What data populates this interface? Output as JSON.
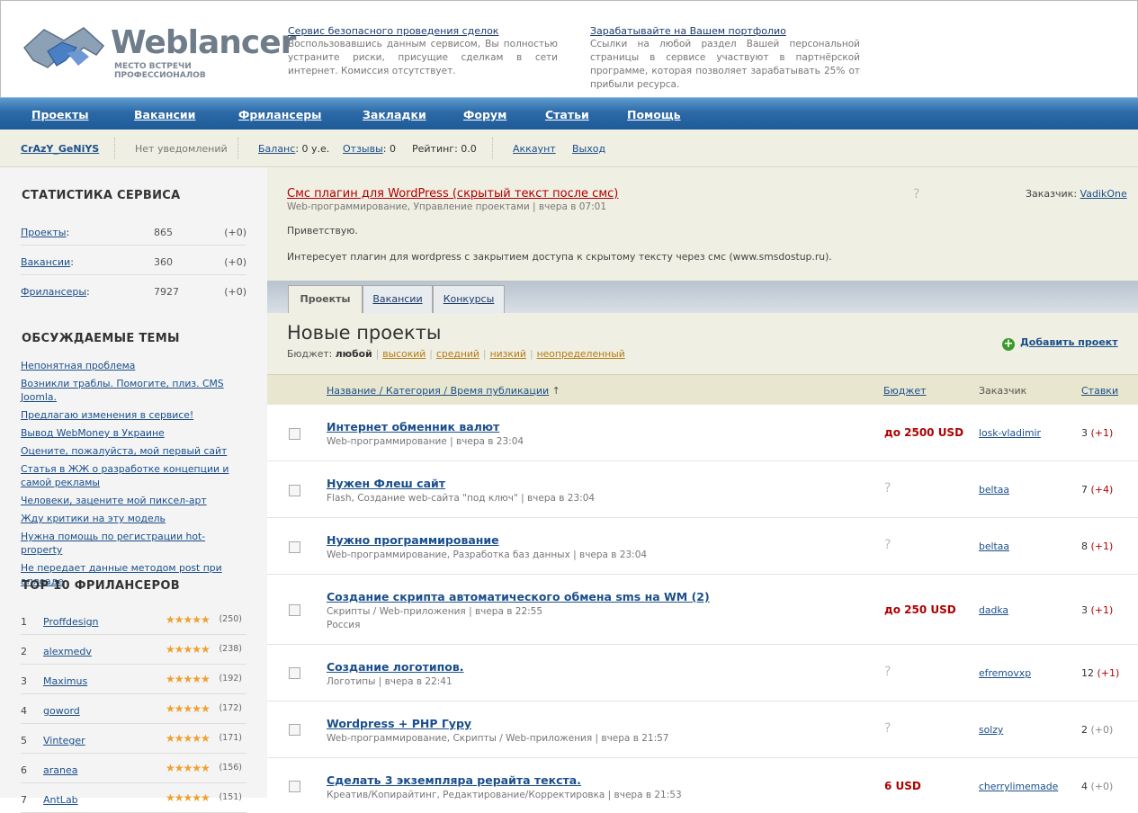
{
  "header": {
    "logo_word": "Weblancer",
    "logo_sub": "МЕСТО ВСТРЕЧИ ПРОФЕССИОНАЛОВ",
    "promo1_title": "Сервис безопасного проведения сделок",
    "promo1_text": "Воспользовавшись данным сервисом, Вы полностью устраните риски, присущие сделкам в сети интернет. Комиссия отсутствует.",
    "promo2_title": "Зарабатывайте на Вашем портфолио",
    "promo2_text": "Ссылки на любой раздел Вашей персональной страницы в сервисе участвуют в партнёрской программе, которая позволяет зарабатывать 25% от прибыли ресурса."
  },
  "nav": [
    "Проекты",
    "Вакансии",
    "Фрилансеры",
    "Закладки",
    "Форум",
    "Статьи",
    "Помощь"
  ],
  "userbar": {
    "username": "CrAzY_GeNiYS",
    "notifications": "Нет уведомлений",
    "balance_label": "Баланс",
    "balance_value": ": 0 у.е.",
    "reviews_label": "Отзывы",
    "reviews_value": ": 0",
    "rating": "Рейтинг: 0.0",
    "account": "Аккаунт",
    "logout": "Выход"
  },
  "sidebar": {
    "stats_title": "СТАТИСТИКА СЕРВИСА",
    "stats": [
      {
        "label": "Проекты",
        "colon": ":",
        "value": "865",
        "delta": "(+0)"
      },
      {
        "label": "Вакансии",
        "colon": ":",
        "value": "360",
        "delta": "(+0)"
      },
      {
        "label": "Фрилансеры",
        "colon": ":",
        "value": "7927",
        "delta": "(+0)"
      }
    ],
    "topics_title": "ОБСУЖДАЕМЫЕ ТЕМЫ",
    "topics": [
      "Непонятная проблема",
      "Возникли траблы. Помогите, плиз. CMS Joomla.",
      "Предлагаю изменения в сервисе!",
      "Вывод WebMoney в Украине",
      "Оцените, пожалуйста, мой первый сайт",
      "Статья в ЖЖ о разработке концепции и самой рекламы",
      "Человеки, зацените мой пиксел-арт",
      "Жду критики на эту модель",
      "Нужна помощь по регистрации hot-property",
      "Не передает данные методом post при аплоаде"
    ],
    "top_title": "TOP 10 ФРИЛАНСЕРОВ",
    "stars": "★★★★★",
    "top": [
      {
        "n": "1",
        "name": "Proffdesign",
        "score": "(250)"
      },
      {
        "n": "2",
        "name": "alexmedv",
        "score": "(238)"
      },
      {
        "n": "3",
        "name": "Maximus",
        "score": "(192)"
      },
      {
        "n": "4",
        "name": "goword",
        "score": "(172)"
      },
      {
        "n": "5",
        "name": "Vinteger",
        "score": "(171)"
      },
      {
        "n": "6",
        "name": "aranea",
        "score": "(156)"
      },
      {
        "n": "7",
        "name": "AntLab",
        "score": "(151)"
      }
    ]
  },
  "ad": {
    "title": "Смс плагин для WordPress (скрытый текст после смс)",
    "meta": "Web-программирование, Управление проектами | вчера в 07:01",
    "question": "?",
    "customer_label": "Заказчик: ",
    "customer": "VadikOne",
    "p1": "Приветствую.",
    "p2": "Интересует плагин для wordpress с закрытием доступа к скрытому тексту через смс (www.smsdostup.ru)."
  },
  "tabs": [
    "Проекты",
    "Вакансии",
    "Конкурсы"
  ],
  "projects": {
    "title": "Новые проекты",
    "budget_label": "Бюджет: ",
    "budget_current": "любой",
    "budget_options": [
      "высокий",
      "средний",
      "низкий",
      "неопределенный"
    ],
    "add_label": "Добавить проект",
    "col_title": "Название / Категория / Время публикации",
    "sort_arrow": "↑",
    "col_budget": "Бюджет",
    "col_customer": "Заказчик",
    "col_bids": "Ставки",
    "rows": [
      {
        "title": "Интернет обменник валют",
        "meta": "Web-программирование | вчера в 23:04",
        "meta2": "",
        "budget": "до 2500 USD",
        "customer": "losk-vladimir",
        "bids": "3",
        "delta": "(+1)"
      },
      {
        "title": "Нужен Флеш сайт",
        "meta": "Flash, Создание web-сайта \"под ключ\" | вчера в 23:04",
        "meta2": "",
        "budget": "?",
        "customer": "beltaa",
        "bids": "7",
        "delta": "(+4)"
      },
      {
        "title": "Нужно программирование",
        "meta": "Web-программирование, Разработка баз данных | вчера в 23:04",
        "meta2": "",
        "budget": "?",
        "customer": "beltaa",
        "bids": "8",
        "delta": "(+1)"
      },
      {
        "title": "Создание скрипта автоматического обмена sms на WM (2)",
        "meta": "Скрипты / Web-приложения | вчера в 22:55",
        "meta2": "Россия",
        "budget": "до 250 USD",
        "customer": "dadka",
        "bids": "3",
        "delta": "(+1)"
      },
      {
        "title": "Создание логотипов.",
        "meta": "Логотипы | вчера в 22:41",
        "meta2": "",
        "budget": "?",
        "customer": "efremovxp",
        "bids": "12",
        "delta": "(+1)"
      },
      {
        "title": "Wordpress + PHP Гуру",
        "meta": "Web-программирование, Скрипты / Web-приложения | вчера в 21:57",
        "meta2": "",
        "budget": "?",
        "customer": "solzy",
        "bids": "2",
        "delta": "(+0)"
      },
      {
        "title": "Сделать 3 экземпляра рерайта текста.",
        "meta": "Креатив/Копирайтинг, Редактирование/Корректировка | вчера в 21:53",
        "meta2": "",
        "budget": "6 USD",
        "customer": "cherrylimemade",
        "bids": "4",
        "delta": "(+0)"
      }
    ]
  },
  "colors": {
    "nav": "#2b6aa8",
    "accent_red": "#b00000",
    "beige": "#f0efe3",
    "link": "#1a4f8b"
  }
}
